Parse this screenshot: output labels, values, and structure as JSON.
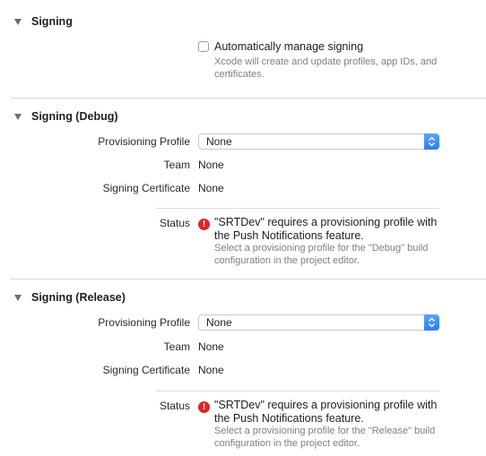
{
  "signing": {
    "title": "Signing",
    "auto_manage_label": "Automatically manage signing",
    "auto_manage_checked": false,
    "auto_manage_help": "Xcode will create and update profiles, app IDs, and certificates."
  },
  "debug": {
    "title": "Signing (Debug)",
    "provisioning_profile_label": "Provisioning Profile",
    "provisioning_profile_value": "None",
    "team_label": "Team",
    "team_value": "None",
    "certificate_label": "Signing Certificate",
    "certificate_value": "None",
    "status_label": "Status",
    "status_icon": "error-icon",
    "status_message": "\"SRTDev\" requires a provisioning profile with the Push Notifications feature.",
    "status_help": "Select a provisioning profile for the \"Debug\" build configuration in the project editor."
  },
  "release": {
    "title": "Signing (Release)",
    "provisioning_profile_label": "Provisioning Profile",
    "provisioning_profile_value": "None",
    "team_label": "Team",
    "team_value": "None",
    "certificate_label": "Signing Certificate",
    "certificate_value": "None",
    "status_label": "Status",
    "status_icon": "error-icon",
    "status_message": "\"SRTDev\" requires a provisioning profile with the Push Notifications feature.",
    "status_help": "Select a provisioning profile for the \"Release\" build configuration in the project editor."
  },
  "colors": {
    "accent": "#2a7ef0",
    "error": "#e02525",
    "help_text": "#7f7f7f"
  }
}
